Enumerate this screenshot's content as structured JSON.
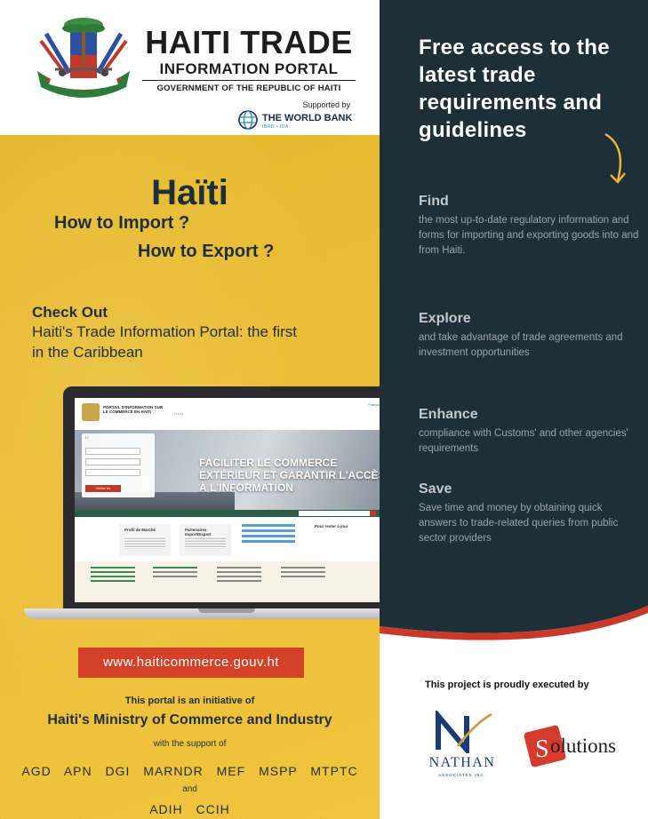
{
  "header": {
    "brand_title": "HAITI TRADE",
    "brand_subtitle": "INFORMATION PORTAL",
    "government": "GOVERNMENT OF THE REPUBLIC OF HAITI",
    "supported_by": "Supported by",
    "world_bank": "THE WORLD BANK",
    "world_bank_sub": "IBRD • IDA"
  },
  "hero": {
    "title": "Haïti",
    "import": "How to Import ?",
    "export": "How to Export ?",
    "check_out": "Check Out",
    "check_out_body": "Haiti's Trade Information Portal: the first in the Caribbean"
  },
  "screen": {
    "site_title": "PORTAIL D'INFORMATION SUR LE COMMERCE EN HAITI",
    "language": "Français | English",
    "slogan": "FACILITER LE COMMERCE EXTÉRIEUR ET GARANTIR L'ACCÈS À L'INFORMATION",
    "search_button": "Vérifier les réglementations",
    "card1": "Profil de Marché",
    "card2": "Partenaires Import/Export",
    "subscribe": "Pour rester à jour"
  },
  "url": "www.haiticommerce.gouv.ht",
  "initiative": {
    "line1": "This portal is an initiative of",
    "ministry": "Haiti's Ministry of Commerce and Industry",
    "support": "with the support of",
    "agencies": "AGD APN DGI MARNDR MEF MSPP MTPTC",
    "and": "and",
    "agencies2": "ADIH CCIH"
  },
  "right": {
    "headline": "Free access to the latest trade requirements and guidelines",
    "sections": [
      {
        "title": "Find",
        "body": "the most up-to-date regulatory information and forms for importing and exporting goods into and from Haiti."
      },
      {
        "title": "Explore",
        "body": "and take advantage of trade agreements and investment opportunities"
      },
      {
        "title": "Enhance",
        "body": "compliance with Customs' and other agencies' requirements"
      },
      {
        "title": "Save",
        "body": "Save time and money by obtaining quick answers to trade-related queries from public sector providers"
      }
    ],
    "executed_by": "This project is proudly executed by",
    "nathan": "NATHAN",
    "nathan_sub": "ASSOCIATES INC.",
    "solutions": "olutions"
  },
  "colors": {
    "yellow": "#efc131",
    "dark": "#1f2f38",
    "red": "#d44127",
    "accent_orange": "#f2b53a"
  },
  "icons": [
    "coat-of-arms-icon",
    "world-bank-globe-icon",
    "curved-arrow-icon",
    "nathan-logo-icon",
    "solutions-logo-icon"
  ]
}
